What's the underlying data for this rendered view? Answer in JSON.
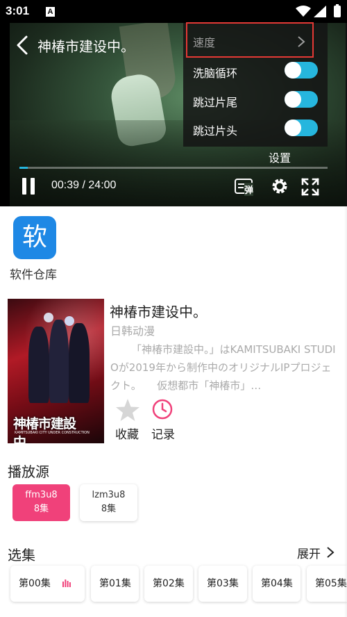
{
  "status_bar": {
    "time": "3:01",
    "notification_icon": "A",
    "icons": [
      "wifi-icon",
      "signal-icon",
      "battery-icon"
    ]
  },
  "player": {
    "title": "神椿市建设中。",
    "elapsed": "00:39",
    "separator": " / ",
    "duration": "24:00",
    "progress_fraction": 0.027,
    "danmaku_char": "弹",
    "settings": {
      "speed_label": "速度",
      "items": [
        {
          "label": "洗脑循环",
          "enabled": true
        },
        {
          "label": "跳过片尾",
          "enabled": true
        },
        {
          "label": "跳过片头",
          "enabled": true
        }
      ],
      "caption": "设置"
    },
    "accent_color": "#26b6de"
  },
  "app_shortcut": {
    "icon_char": "软",
    "label": "软件仓库"
  },
  "anime": {
    "poster_title": "神椿市建設中。",
    "poster_subtitle": "KAMITSUBAKI CITY UNDER CONSTRUCTION",
    "title": "神椿市建设中。",
    "category": "日韩动漫",
    "description": "「神椿市建設中。」はKAMITSUBAKI STUDIOが2019年から制作中のオリジナルIPプロジェクト。　　仮想都市「神椿市」…",
    "favorite_label": "收藏",
    "history_label": "记录"
  },
  "sources": {
    "title": "播放源",
    "items": [
      {
        "name": "ffm3u8",
        "count": "8集",
        "active": true
      },
      {
        "name": "lzm3u8",
        "count": "8集",
        "active": false
      }
    ],
    "active_color": "#f0417a"
  },
  "episodes": {
    "title": "选集",
    "expand_label": "展开",
    "items": [
      "第00集",
      "第01集",
      "第02集",
      "第03集",
      "第04集",
      "第05集"
    ]
  }
}
